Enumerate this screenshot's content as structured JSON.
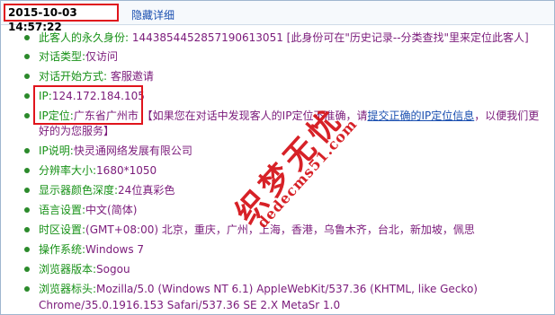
{
  "header": {
    "timestamp": "2015-10-03 14:57:22",
    "hide_link": "隐藏详细"
  },
  "details": {
    "permanent_id": {
      "label": "此客人的永久身份:",
      "value": "1443854452857190613051",
      "note": "[此身份可在\"历史记录--分类查找\"里来定位此客人]"
    },
    "chat_type": {
      "label": "对话类型:",
      "value": "仅访问"
    },
    "chat_start": {
      "label": "对话开始方式:",
      "value": "客服邀请"
    },
    "ip": {
      "label": "IP:",
      "value": "124.172.184.105"
    },
    "ip_location": {
      "label": "IP定位:",
      "value": "广东省广州市",
      "note_before": "【如果您在对话中发现客人的IP定位不准确，请",
      "link": "提交正确的IP定位信息",
      "note_after": "，以便我们更",
      "note_line2": "好的为您服务】"
    },
    "ip_desc": {
      "label": "IP说明:",
      "value": "快灵通网络发展有限公司"
    },
    "resolution": {
      "label": "分辨率大小:",
      "value": "1680*1050"
    },
    "color_depth": {
      "label": "显示器颜色深度:",
      "value": "24位真彩色"
    },
    "language": {
      "label": "语言设置:",
      "value": "中文(简体)"
    },
    "timezone": {
      "label": "时区设置:",
      "value": "(GMT+08:00) 北京，重庆，广州，上海，香港，乌鲁木齐，台北，新加坡，佩思"
    },
    "os": {
      "label": "操作系统:",
      "value": "Windows 7"
    },
    "browser_version": {
      "label": "浏览器版本:",
      "value": "Sogou"
    },
    "user_agent": {
      "label": "浏览器标头:",
      "value_line1": "Mozilla/5.0 (Windows NT 6.1) AppleWebKit/537.36 (KHTML, like Gecko)",
      "value_line2": "Chrome/35.0.1916.153 Safari/537.36 SE 2.X MetaSr 1.0"
    }
  },
  "watermark": {
    "text_cn": "织梦无忧",
    "text_en": "dedecms51.com"
  },
  "colors": {
    "label_green": "#179117",
    "value_purple": "#7a1a7a",
    "link_blue": "#1a4fb0",
    "highlight_red": "#e0141c"
  }
}
